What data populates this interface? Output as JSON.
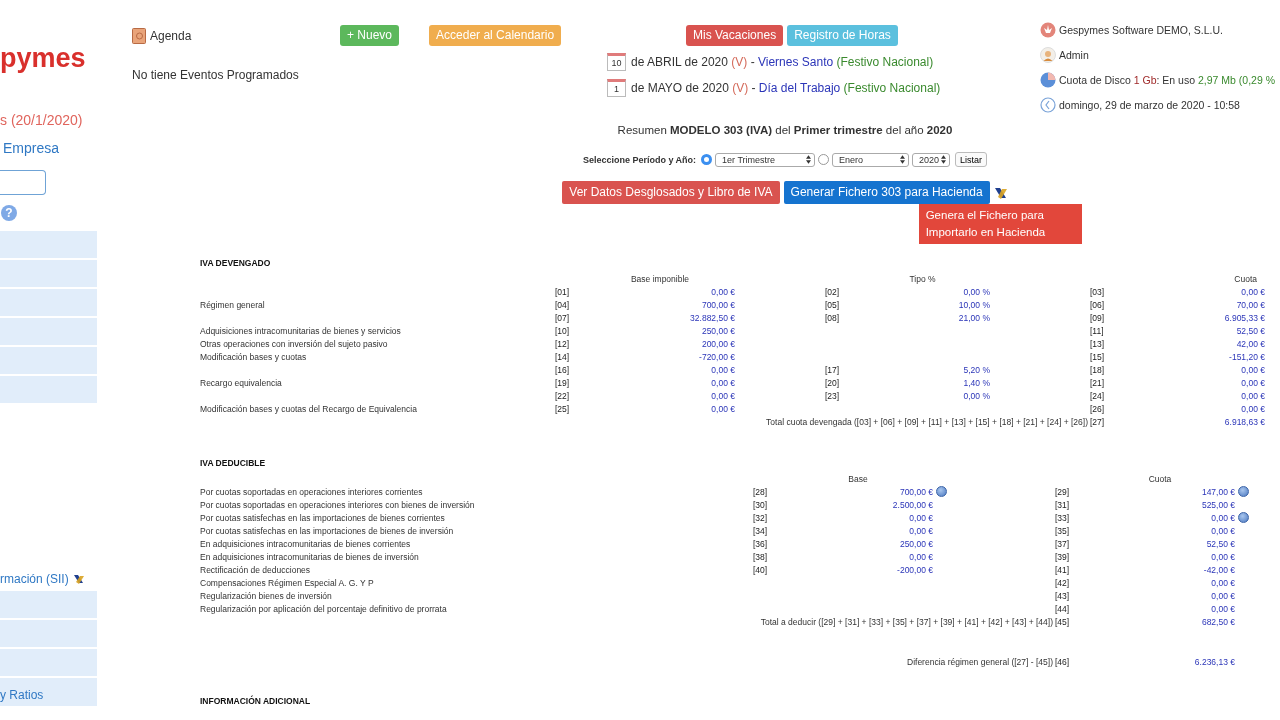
{
  "sidebar": {
    "logo": "pymes",
    "version": "s (20/1/2020)",
    "company_link": "Empresa",
    "help": "?",
    "menu_top": [
      {
        "kind": "blank"
      },
      {
        "kind": "blank"
      },
      {
        "kind": "blank"
      },
      {
        "kind": "blank"
      },
      {
        "kind": "blank"
      },
      {
        "kind": "blank"
      }
    ],
    "sii_link": "rmación (SII)",
    "menu_bottom": [
      {
        "kind": "blank"
      },
      {
        "kind": "blank"
      },
      {
        "kind": "blank"
      },
      {
        "kind": "link",
        "label": "y Ratios"
      }
    ]
  },
  "agenda": {
    "title": "Agenda",
    "new_button": "+ Nuevo",
    "calendar_button": "Acceder al Calendario",
    "empty": "No tiene Eventos Programados"
  },
  "top_buttons": [
    {
      "label": "Mis Vacaciones",
      "kind": "danger"
    },
    {
      "label": "Registro de Horas",
      "kind": "info"
    }
  ],
  "holidays": [
    {
      "day": "10",
      "date": "de ABRIL de 2020",
      "tag": "(V)",
      "separator": "-",
      "name": "Viernes Santo",
      "type": "(Festivo Nacional)"
    },
    {
      "day": "1",
      "date": "de MAYO de 2020",
      "tag": "(V)",
      "separator": "-",
      "name": "Día del Trabajo",
      "type": "(Festivo Nacional)"
    }
  ],
  "account": {
    "company": "Gespymes Software DEMO, S.L.U.",
    "user": "Admin",
    "disk_label": "Cuota de Disco",
    "disk_total": "1 Gb",
    "disk_used_label": ": En uso",
    "disk_used": "2,97 Mb (0,29 %",
    "datetime": "domingo, 29 de marzo de 2020 - 10:58"
  },
  "summary": {
    "title": "Resumen **MODELO 303 (IVA)** del **Primer trimestre** del año **2020**",
    "period_label": "Seleccione Período y Año:",
    "choices": [
      {
        "selected": true,
        "value": "1er Trimestre"
      },
      {
        "selected": false,
        "value": "Enero"
      }
    ],
    "year": "2020",
    "list_button": "Listar",
    "buttons": [
      {
        "label": "Ver Datos Desglosados y Libro de IVA",
        "kind": "danger"
      },
      {
        "label": "Generar Fichero 303 para Hacienda",
        "kind": "primary"
      }
    ],
    "tooltip": "Genera el Fichero para Importarlo en Hacienda"
  },
  "devengado": {
    "heading": "IVA DEVENGADO",
    "columns": [
      "Base imponible",
      "Tipo %",
      "Cuota"
    ],
    "rows": [
      {
        "c1": "[01]",
        "v1": "0,00 €",
        "c2": "[02]",
        "v2": "0,00 %",
        "c3": "[03]",
        "v3": "0,00 €"
      },
      {
        "label": "Régimen general",
        "c1": "[04]",
        "v1": "700,00 €",
        "c2": "[05]",
        "v2": "10,00 %",
        "c3": "[06]",
        "v3": "70,00 €"
      },
      {
        "c1": "[07]",
        "v1": "32.882,50 €",
        "c2": "[08]",
        "v2": "21,00 %",
        "c3": "[09]",
        "v3": "6.905,33 €"
      },
      {
        "label": "Adquisiciones intracomunitarias de bienes y servicios",
        "c1": "[10]",
        "v1": "250,00 €",
        "c3": "[11]",
        "v3": "52,50 €"
      },
      {
        "label": "Otras operaciones con inversión del sujeto pasivo",
        "c1": "[12]",
        "v1": "200,00 €",
        "c3": "[13]",
        "v3": "42,00 €"
      },
      {
        "label": "Modificación bases y cuotas",
        "c1": "[14]",
        "v1": "-720,00 €",
        "c3": "[15]",
        "v3": "-151,20 €"
      },
      {
        "c1": "[16]",
        "v1": "0,00 €",
        "c2": "[17]",
        "v2": "5,20 %",
        "c3": "[18]",
        "v3": "0,00 €"
      },
      {
        "label": "Recargo equivalencia",
        "c1": "[19]",
        "v1": "0,00 €",
        "c2": "[20]",
        "v2": "1,40 %",
        "c3": "[21]",
        "v3": "0,00 €"
      },
      {
        "c1": "[22]",
        "v1": "0,00 €",
        "c2": "[23]",
        "v2": "0,00 %",
        "c3": "[24]",
        "v3": "0,00 €"
      },
      {
        "label": "Modificación bases y cuotas del Recargo de Equivalencia",
        "c1": "[25]",
        "v1": "0,00 €",
        "c3": "[26]",
        "v3": "0,00 €"
      }
    ],
    "total": {
      "label": "Total cuota devengada ([03] + [06] + [09] + [11] + [13] + [15] + [18] + [21] + [24] + [26])",
      "code": "[27]",
      "value": "6.918,63 €"
    }
  },
  "deducible": {
    "heading": "IVA DEDUCIBLE",
    "columns": [
      "Base",
      "Cuota"
    ],
    "rows": [
      {
        "label": "Por cuotas soportadas en operaciones interiores corrientes",
        "c1": "[28]",
        "v1": "700,00 €",
        "info1": true,
        "c2": "[29]",
        "v2": "147,00 €",
        "info2": true
      },
      {
        "label": "Por cuotas soportadas en operaciones interiores con bienes de inversión",
        "c1": "[30]",
        "v1": "2.500,00 €",
        "info1": false,
        "c2": "[31]",
        "v2": "525,00 €",
        "info2": false
      },
      {
        "label": "Por cuotas satisfechas en las importaciones de bienes corrientes",
        "c1": "[32]",
        "v1": "0,00 €",
        "info1": false,
        "c2": "[33]",
        "v2": "0,00 €",
        "info2": true
      },
      {
        "label": "Por cuotas satisfechas en las importaciones de bienes de inversión",
        "c1": "[34]",
        "v1": "0,00 €",
        "info1": false,
        "c2": "[35]",
        "v2": "0,00 €",
        "info2": false
      },
      {
        "label": "En adquisiciones intracomunitarias de bienes corrientes",
        "c1": "[36]",
        "v1": "250,00 €",
        "info1": false,
        "c2": "[37]",
        "v2": "52,50 €",
        "info2": false
      },
      {
        "label": "En adquisiciones intracomunitarias de bienes de inversión",
        "c1": "[38]",
        "v1": "0,00 €",
        "info1": false,
        "c2": "[39]",
        "v2": "0,00 €",
        "info2": false
      },
      {
        "label": "Rectificación de deducciones",
        "c1": "[40]",
        "v1": "-200,00 €",
        "info1": false,
        "c2": "[41]",
        "v2": "-42,00 €",
        "info2": false
      },
      {
        "label": "Compensaciones Régimen Especial A. G. Y P",
        "c2": "[42]",
        "v2": "0,00 €",
        "info2": false
      },
      {
        "label": "Regularización bienes de inversión",
        "c2": "[43]",
        "v2": "0,00 €",
        "info2": false
      },
      {
        "label": "Regularización por aplicación del porcentaje definitivo de prorrata",
        "c2": "[44]",
        "v2": "0,00 €",
        "info2": false
      }
    ],
    "total": {
      "label": "Total a deducir ([29] + [31] + [33] + [35] + [37] + [39] + [41] + [42] + [43] + [44])",
      "code": "[45]",
      "value": "682,50 €"
    }
  },
  "difference": {
    "label": "Diferencia régimen general ([27] - [45])",
    "code": "[46]",
    "value": "6.236,13 €"
  },
  "additional_heading": "INFORMACIÓN ADICIONAL"
}
